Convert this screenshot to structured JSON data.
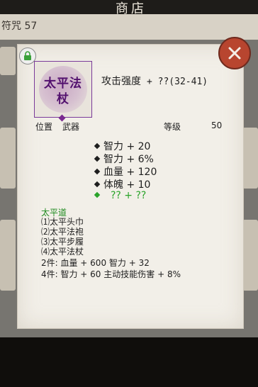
{
  "background": {
    "shop_title": "商店",
    "currency_text": "符咒 57"
  },
  "dialog": {
    "item": {
      "icon_name": "太平法杖",
      "attack_label": "攻击强度",
      "attack_value": "+ ??(32-41)",
      "position_label": "位置",
      "position_value": "武器",
      "level_label": "等级",
      "level_value": "50"
    },
    "stats": [
      {
        "text": "智力 + 20",
        "color": "#1e1e1e"
      },
      {
        "text": "智力 + 6%",
        "color": "#1e1e1e"
      },
      {
        "text": "血量 + 120",
        "color": "#1e1e1e"
      },
      {
        "text": "体魄 + 10",
        "color": "#1e1e1e"
      },
      {
        "text": "?? + ??",
        "color": "#2aa32a"
      }
    ],
    "set": {
      "name": "太平道",
      "pieces": [
        "⑴太平头巾",
        "⑵太平法袍",
        "⑶太平步履",
        "⑷太平法杖"
      ],
      "bonuses": [
        "2件: 血量 + 600 智力 + 32",
        "4件: 智力 + 60 主动技能伤害 + 8%"
      ]
    }
  },
  "icons": {
    "lock": "lock-icon",
    "close": "close-icon"
  },
  "colors": {
    "set_name": "#1f8a1f",
    "item_rarity": "#52106e",
    "close_button": "#b8452f"
  }
}
